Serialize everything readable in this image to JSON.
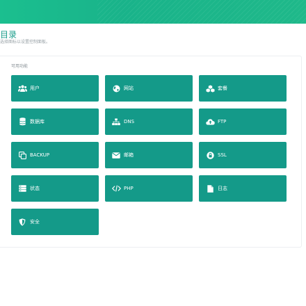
{
  "header": {
    "title": "目录",
    "subtitle": "选择图标以设置控制面板。"
  },
  "panel": {
    "heading": "可用功能"
  },
  "tiles": [
    {
      "label": "用户",
      "icon": "users-icon"
    },
    {
      "label": "网站",
      "icon": "globe-icon"
    },
    {
      "label": "套餐",
      "icon": "cubes-icon"
    },
    {
      "label": "数据库",
      "icon": "database-icon"
    },
    {
      "label": "DNS",
      "icon": "sitemap-icon"
    },
    {
      "label": "FTP",
      "icon": "cloud-upload-icon"
    },
    {
      "label": "BACKUP",
      "icon": "copy-icon"
    },
    {
      "label": "邮箱",
      "icon": "envelope-icon"
    },
    {
      "label": "SSL",
      "icon": "lock-icon"
    },
    {
      "label": "状态",
      "icon": "server-icon"
    },
    {
      "label": "PHP",
      "icon": "code-icon"
    },
    {
      "label": "日志",
      "icon": "file-icon"
    },
    {
      "label": "安全",
      "icon": "shield-icon"
    }
  ],
  "colors": {
    "accent": "#149a89",
    "banner": "#1bbf8f",
    "title": "#1a9c8a"
  }
}
